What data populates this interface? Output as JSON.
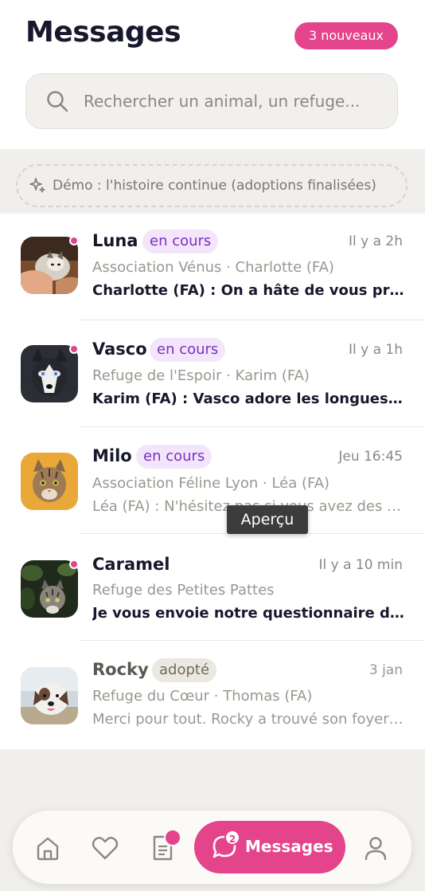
{
  "header": {
    "title": "Messages",
    "new_badge": "3 nouveaux"
  },
  "search": {
    "placeholder": "Rechercher un animal, un refuge..."
  },
  "demo_banner": {
    "icon": "sparkles-icon",
    "label": "Démo : l'histoire continue (adoptions finalisées)"
  },
  "conversations": [
    {
      "name": "Luna",
      "status": "en cours",
      "time": "Il y a 2h",
      "subtitle": "Association Vénus · Charlotte (FA)",
      "preview": "Charlotte (FA) : On a hâte de vous présenter Luna !",
      "unread": true
    },
    {
      "name": "Vasco",
      "status": "en cours",
      "time": "Il y a 1h",
      "subtitle": "Refuge de l'Espoir · Karim (FA)",
      "preview": "Karim (FA) : Vasco adore les longues balades en forêt",
      "unread": true
    },
    {
      "name": "Milo",
      "status": "en cours",
      "time": "Jeu 16:45",
      "subtitle": "Association Féline Lyon · Léa (FA)",
      "preview": "Léa (FA) : N'hésitez pas si vous avez des questions",
      "unread": false
    },
    {
      "name": "Caramel",
      "status": "",
      "time": "Il y a 10 min",
      "subtitle": "Refuge des Petites Pattes",
      "preview": "Je vous envoie notre questionnaire d'adoption",
      "unread": true
    },
    {
      "name": "Rocky",
      "status": "adopté",
      "time": "3 jan",
      "subtitle": "Refuge du Cœur · Thomas (FA)",
      "preview": "Merci pour tout. Rocky a trouvé son foyer pour toujours",
      "unread": false
    }
  ],
  "tooltip": {
    "label": "Aperçu"
  },
  "bottom_nav": {
    "items": [
      {
        "icon": "home-icon"
      },
      {
        "icon": "heart-icon"
      },
      {
        "icon": "document-icon"
      },
      {
        "icon": "chat-icon",
        "label": "Messages",
        "count": "2"
      },
      {
        "icon": "user-icon"
      }
    ]
  },
  "colors": {
    "accent": "#e4448c",
    "status_purple": "#7b2fc2"
  }
}
